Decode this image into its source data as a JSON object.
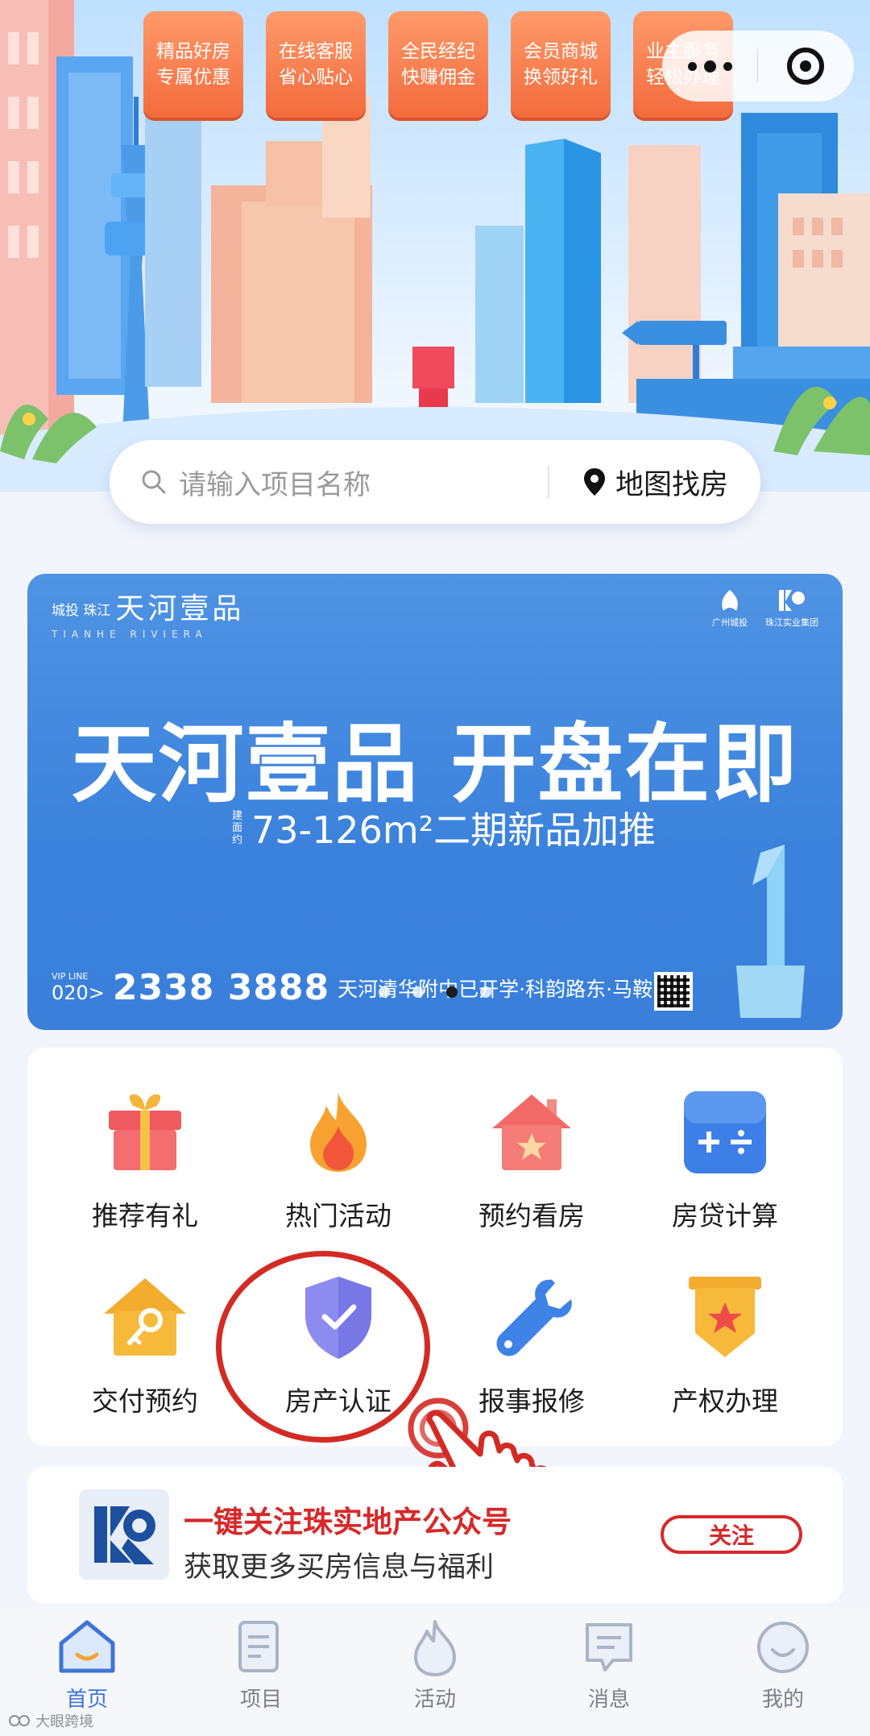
{
  "hero": {
    "quick_tags": [
      {
        "line1": "精品好房",
        "line2": "专属优惠"
      },
      {
        "line1": "在线客服",
        "line2": "省心贴心"
      },
      {
        "line1": "全民经纪",
        "line2": "快赚佣金"
      },
      {
        "line1": "会员商城",
        "line2": "换领好礼"
      },
      {
        "line1": "业主服务",
        "line2": "轻松办理"
      }
    ]
  },
  "search": {
    "placeholder": "请输入项目名称",
    "map_label": "地图找房"
  },
  "promo": {
    "brand_small": "城投 珠江",
    "brand_name": "天河壹品",
    "brand_en": "TIANHE RIVIERA",
    "logo_left": "广州城投",
    "logo_right": "珠江实业集团",
    "title": "天河壹品 开盘在即",
    "sub_prefix": "建面约",
    "sub_text": "73-126m²二期新品加推",
    "vip": "VIP LINE",
    "phone_prefix": "020>",
    "phone": "2338 3888",
    "address": "天河清华附中已开学·科韵路东·马鞍山畔",
    "slide_count": 4,
    "active_slide": 2
  },
  "services": [
    {
      "label": "推荐有礼",
      "icon": "gift-icon"
    },
    {
      "label": "热门活动",
      "icon": "flame-icon"
    },
    {
      "label": "预约看房",
      "icon": "house-star-icon"
    },
    {
      "label": "房贷计算",
      "icon": "calculator-icon"
    },
    {
      "label": "交付预约",
      "icon": "house-key-icon"
    },
    {
      "label": "房产认证",
      "icon": "shield-check-icon"
    },
    {
      "label": "报事报修",
      "icon": "wrench-icon"
    },
    {
      "label": "产权办理",
      "icon": "badge-star-icon"
    }
  ],
  "follow": {
    "title": "一键关注珠实地产公众号",
    "subtitle": "获取更多买房信息与福利",
    "button": "关注"
  },
  "tabbar": {
    "items": [
      {
        "label": "首页",
        "icon": "home-icon",
        "active": true
      },
      {
        "label": "项目",
        "icon": "document-icon",
        "active": false
      },
      {
        "label": "活动",
        "icon": "flame-outline-icon",
        "active": false
      },
      {
        "label": "消息",
        "icon": "message-icon",
        "active": false
      },
      {
        "label": "我的",
        "icon": "smile-icon",
        "active": false
      }
    ]
  },
  "watermark": "大眼跨境",
  "colors": {
    "accent_orange": "#f36b3d",
    "promo_blue": "#3b82dc",
    "brand_red": "#d7282a",
    "tab_active": "#3f74d8"
  }
}
